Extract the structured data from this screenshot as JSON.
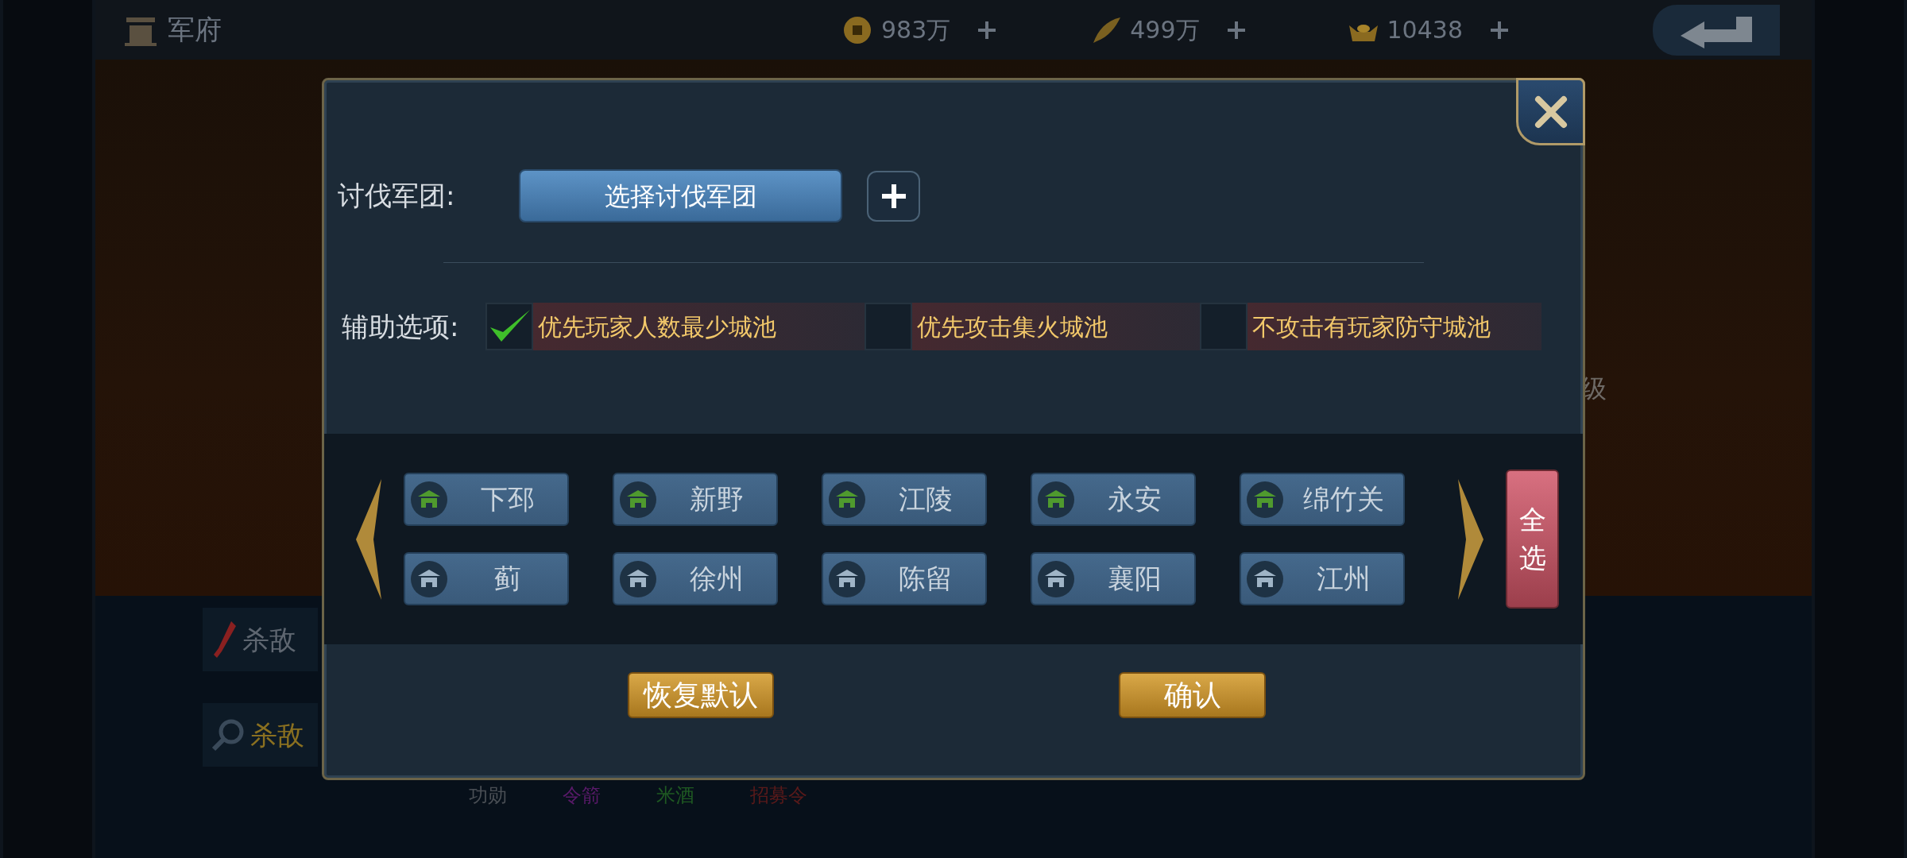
{
  "top_bar": {
    "title": "军府",
    "resources": [
      {
        "kind": "coin",
        "amount": "983万"
      },
      {
        "kind": "feather",
        "amount": "499万"
      },
      {
        "kind": "ingot",
        "amount": "10438"
      }
    ]
  },
  "background": {
    "side_buttons": [
      {
        "kind": "sword",
        "label": "杀敌"
      },
      {
        "kind": "search",
        "label": "杀敌"
      }
    ],
    "level_text": "级",
    "items": [
      {
        "label": "功勋",
        "color": "#4a4f55"
      },
      {
        "label": "令箭",
        "color": "#5a1a6a"
      },
      {
        "label": "米酒",
        "color": "#1f5a22"
      },
      {
        "label": "招募令",
        "color": "#5a1a1a"
      }
    ]
  },
  "dialog": {
    "legion_label": "讨伐军团:",
    "legion_button": "选择讨伐军团",
    "options_label": "辅助选项:",
    "options": [
      {
        "label": "优先玩家人数最少城池",
        "checked": true
      },
      {
        "label": "优先攻击集火城池",
        "checked": false
      },
      {
        "label": "不攻击有玩家防守城池",
        "checked": false
      }
    ],
    "cities": [
      {
        "name": "下邳",
        "color": "#4f9a2e"
      },
      {
        "name": "新野",
        "color": "#4f9a2e"
      },
      {
        "name": "江陵",
        "color": "#4f9a2e"
      },
      {
        "name": "永安",
        "color": "#4f9a2e"
      },
      {
        "name": "绵竹关",
        "color": "#4f9a2e"
      },
      {
        "name": "蓟",
        "color": "#9fb4c6"
      },
      {
        "name": "徐州",
        "color": "#9fb4c6"
      },
      {
        "name": "陈留",
        "color": "#9fb4c6"
      },
      {
        "name": "襄阳",
        "color": "#9fb4c6"
      },
      {
        "name": "江州",
        "color": "#9fb4c6"
      }
    ],
    "select_all": "全选",
    "buttons": [
      "恢复默认",
      "确认"
    ]
  }
}
